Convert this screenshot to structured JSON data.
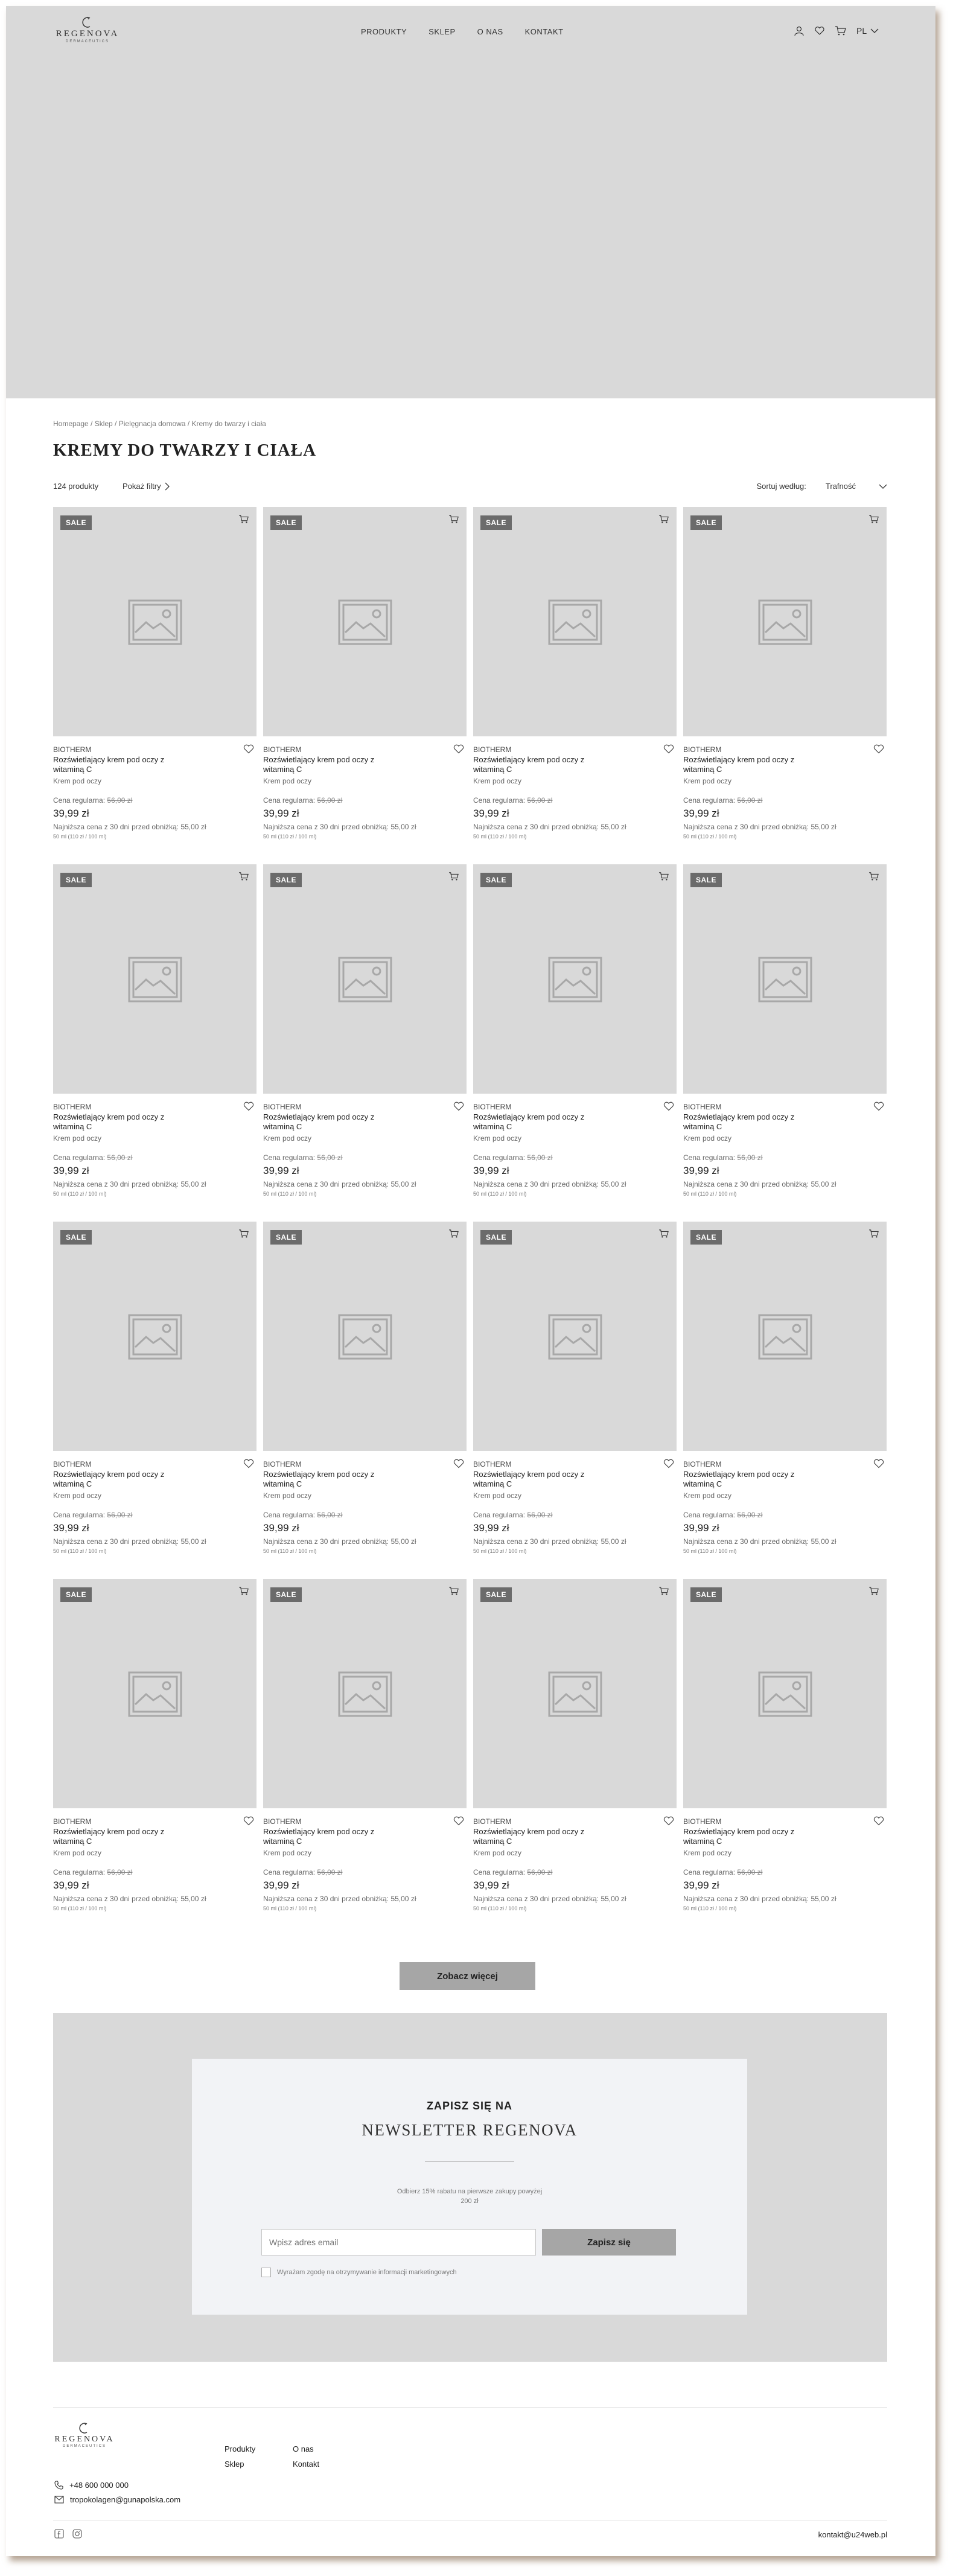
{
  "brand": {
    "name": "REGENOVA",
    "tagline": "DERMACEUTICS"
  },
  "nav": [
    "PRODUKTY",
    "SKLEP",
    "O NAS",
    "KONTAKT"
  ],
  "header": {
    "lang": "PL"
  },
  "breadcrumb": "Homepage / Sklep / Pielęgnacja domowa / Kremy do twarzy i ciała",
  "page_title": "KREMY DO TWARZY I CIAŁA",
  "toolbar": {
    "count": "124 produkty",
    "filters": "Pokaż filtry",
    "sort_label": "Sortuj według:",
    "sort_value": "Trafność"
  },
  "product_template": {
    "badge": "SALE",
    "brand": "BIOTHERM",
    "name": "Rozświetlający krem pod oczy z witaminą C",
    "category": "Krem pod oczy",
    "regular_label": "Cena regularna:",
    "regular_price": "56,00 zł",
    "price": "39,99 zł",
    "lowest": "Najniższa cena z 30 dni przed obniżką: 55,00 zł",
    "unit": "50 ml (110 zł / 100 ml)"
  },
  "products_count_shown": 16,
  "more_button": "Zobacz więcej",
  "newsletter": {
    "kicker": "ZAPISZ SIĘ NA",
    "title": "NEWSLETTER REGENOVA",
    "desc": "Odbierz 15% rabatu na pierwsze zakupy powyżej 200 zł",
    "placeholder": "Wpisz adres email",
    "button": "Zapisz się",
    "consent": "Wyrażam zgodę na otrzymywanie informacji marketingowych"
  },
  "footer": {
    "links": [
      "Produkty",
      "O nas",
      "Sklep",
      "Kontakt"
    ],
    "phone": "+48 600 000 000",
    "email": "tropokolagen@gunapolska.com",
    "credit": "kontakt@u24web.pl"
  },
  "colors": {
    "placeholder_bg": "#d9d9d9",
    "badge": "#6b6b6b",
    "button": "#a6a6a6",
    "newsletter_box": "#f2f3f6"
  }
}
